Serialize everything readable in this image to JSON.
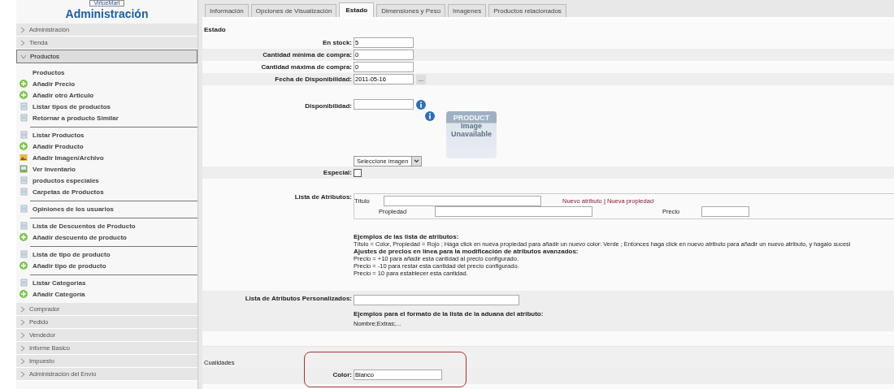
{
  "sidebar": {
    "logo": "VirtueMart",
    "title": "Administración",
    "sections_before": [
      {
        "label": "Administración",
        "expanded": false
      },
      {
        "label": "Tienda",
        "expanded": false
      }
    ],
    "active_section": {
      "label": "Productos",
      "expanded": true
    },
    "groups": [
      [
        {
          "label": "Productos",
          "kind": "none"
        },
        {
          "label": "Añadir Precio",
          "kind": "add"
        },
        {
          "label": "Añadir otro Articulo",
          "kind": "add"
        },
        {
          "label": "Listar tipos de productos",
          "kind": "list"
        },
        {
          "label": "Retornar a producto Similar",
          "kind": "list"
        }
      ],
      [
        {
          "label": "Listar Productos",
          "kind": "list"
        },
        {
          "label": "Añadir Producto",
          "kind": "add"
        },
        {
          "label": "Añadir Imagen/Archivo",
          "kind": "image"
        },
        {
          "label": "Ver Inventario",
          "kind": "inventory"
        },
        {
          "label": "productos especiales",
          "kind": "list"
        },
        {
          "label": "Carpetas de Productos",
          "kind": "list"
        }
      ],
      [
        {
          "label": "Opiniones de los usuarios",
          "kind": "list"
        }
      ],
      [
        {
          "label": "Lista de Descuentos de Producto",
          "kind": "list"
        },
        {
          "label": "Añadir descuento de producto",
          "kind": "add"
        }
      ],
      [
        {
          "label": "Lista de tipo de producto",
          "kind": "list"
        },
        {
          "label": "Añadir tipo de producto",
          "kind": "add"
        }
      ],
      [
        {
          "label": "Listar Categorias",
          "kind": "list"
        },
        {
          "label": "Añadir Categoría",
          "kind": "add"
        }
      ]
    ],
    "sections_after": [
      {
        "label": "Comprador",
        "expanded": false
      },
      {
        "label": "Pedido",
        "expanded": false
      },
      {
        "label": "Vendedor",
        "expanded": false
      },
      {
        "label": "Informe Basico",
        "expanded": false
      },
      {
        "label": "Impuesto",
        "expanded": false
      },
      {
        "label": "Administración del Envío",
        "expanded": false
      }
    ]
  },
  "tabs": [
    {
      "label": "Información",
      "selected": false
    },
    {
      "label": "Opciones de Visualización",
      "selected": false
    },
    {
      "label": "Estado",
      "selected": true
    },
    {
      "label": "Dimensiones y Peso",
      "selected": false
    },
    {
      "label": "Imagenes",
      "selected": false
    },
    {
      "label": "Productos relacionados",
      "selected": false
    }
  ],
  "section_title": "Estado",
  "fields": [
    {
      "label": "En stock:",
      "value": "5"
    },
    {
      "label": "Cantidad mínima de compra:",
      "value": "0"
    },
    {
      "label": "Cantidad máxima de compra:",
      "value": "0"
    },
    {
      "label": "Fecha de Disponibilidad:",
      "value": "2011-05-16",
      "button": "..."
    }
  ],
  "availability": {
    "label": "Disponibilidad:",
    "image_text_1": "PRODUCT",
    "image_text_2": "Image",
    "image_text_3": "Unavailable",
    "select": "Seleccione imagen"
  },
  "special": {
    "label": "Especial:",
    "checked": false
  },
  "attributes": {
    "label": "Lista de Atributos:",
    "title_label": "Título",
    "property_label": "Propiedad",
    "price_label": "Precio",
    "new_attribute": "Nuevo atributo",
    "separator": "|",
    "new_property": "Nueva propiedad",
    "examples_title": "Ejemplos de las lista de atributos:",
    "examples_line": "Título = Color, Propiedad = Rojo ; Haga click en nueva propiedad para añadir un nuevo color: Verde ; Entonces haga click en nuevo atributo para añadir un nuevo atributo, y hagalo sucesi",
    "adjust_title": "Ajustes de precios en línea para la modificación de atributos avanzados:",
    "adjust_lines": [
      "Precio = +10 para añadir esta cantidad al precio configurado.",
      "Precio = -10 para restar esta cantidad del precio configurado.",
      "Precio = 10 para establecer esta cantidad."
    ]
  },
  "custom_attributes": {
    "label": "Lista de Atributos Personalizados:",
    "examples_title": "Ejemplos para el formato de la lista de la aduana del atributo:",
    "example": "Nombre;Extras;..."
  },
  "qualities": {
    "title": "Cualidades",
    "label": "Color:",
    "value": "Blanco"
  }
}
